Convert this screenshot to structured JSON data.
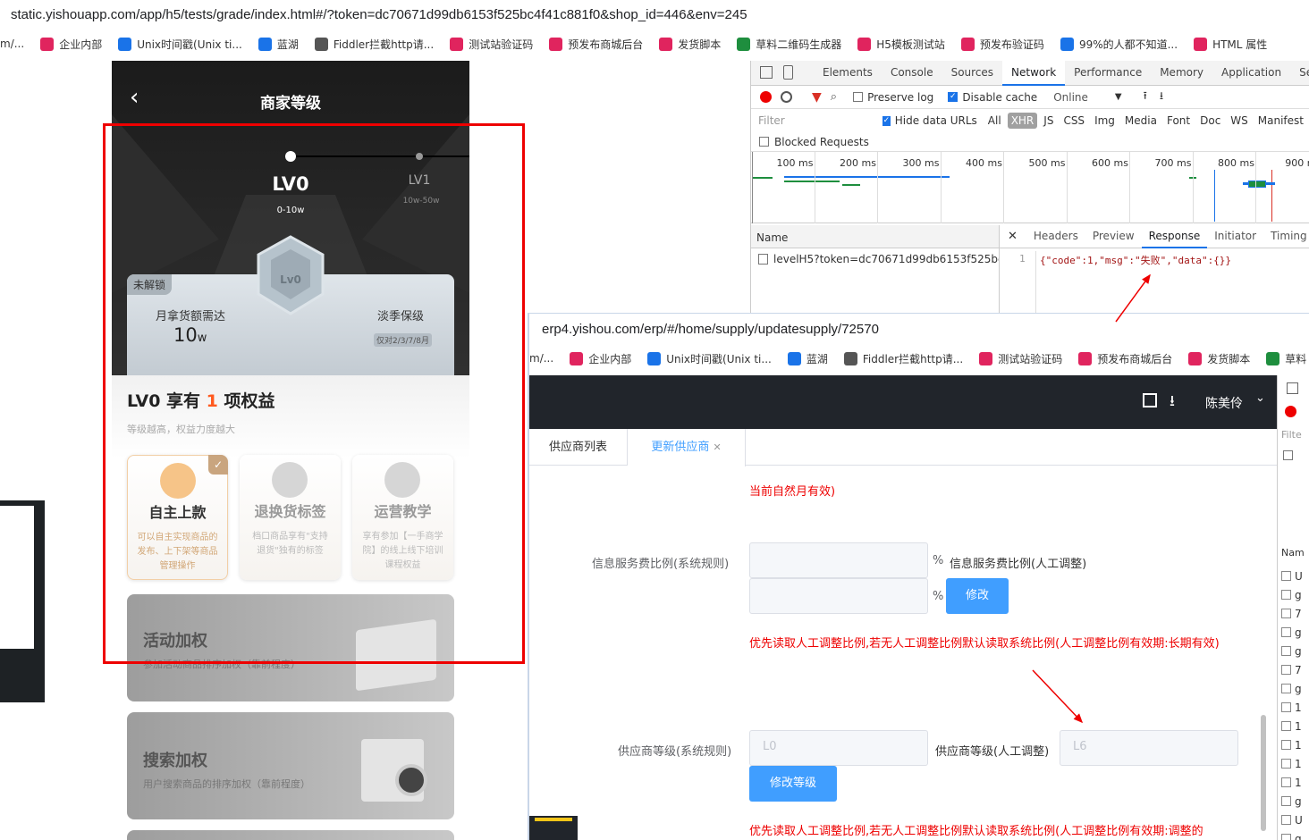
{
  "browser_top": {
    "url": "static.yishouapp.com/app/h5/tests/grade/index.html#/?token=dc70671d99db6153f525bc4f41c881f0&shop_id=446&env=245",
    "bookmarks": [
      "m/...",
      "企业内部",
      "Unix时间戳(Unix ti...",
      "蓝湖",
      "Fiddler拦截http请...",
      "测试站验证码",
      "预发布商城后台",
      "发货脚本",
      "草料二维码生成器",
      "H5模板测试站",
      "预发布验证码",
      "99%的人都不知道...",
      "HTML 属性"
    ]
  },
  "h5": {
    "title": "商家等级",
    "level_current": "LV0",
    "level_current_range": "0-10w",
    "level_next": "LV1",
    "level_next_range": "10w-50w",
    "badge_text": "Lv0",
    "locked_tag": "未解锁",
    "monthly_label": "月拿货额需达",
    "monthly_value": "10",
    "monthly_unit": "w",
    "offseason_label": "淡季保级",
    "offseason_tag": "仅对2/3/7/8月",
    "rights_prefix": "LV0 享有",
    "rights_count": "1",
    "rights_suffix": "项权益",
    "rights_sub": "等级越高，权益力度越大",
    "cards": [
      {
        "title": "自主上款",
        "desc": "可以自主实现商品的发布、上下架等商品管理操作"
      },
      {
        "title": "退换货标签",
        "desc": "档口商品享有\"支持退货\"独有的标签"
      },
      {
        "title": "运营教学",
        "desc": "享有参加【一手商学院】的线上线下培训课程权益"
      }
    ],
    "activity_title": "活动加权",
    "activity_desc": "参加活动商品排序加权（靠前程度）",
    "search_title": "搜索加权",
    "search_desc": "用户搜索商品的排序加权（靠前程度）"
  },
  "devtools": {
    "tabs": [
      "Elements",
      "Console",
      "Sources",
      "Network",
      "Performance",
      "Memory",
      "Application",
      "Secur"
    ],
    "active_tab": "Network",
    "preserve_log": "Preserve log",
    "disable_cache": "Disable cache",
    "online": "Online",
    "filter_placeholder": "Filter",
    "hide_data_urls": "Hide data URLs",
    "filter_types": [
      "All",
      "XHR",
      "JS",
      "CSS",
      "Img",
      "Media",
      "Font",
      "Doc",
      "WS",
      "Manifest"
    ],
    "blocked": "Blocked Requests",
    "timeline": [
      "100 ms",
      "200 ms",
      "300 ms",
      "400 ms",
      "500 ms",
      "600 ms",
      "700 ms",
      "800 ms",
      "900 m"
    ],
    "name_header": "Name",
    "request_name": "levelH5?token=dc70671d99db6153f525bc4f...",
    "detail_tabs": [
      "Headers",
      "Preview",
      "Response",
      "Initiator",
      "Timing"
    ],
    "active_detail": "Response",
    "line_no": "1",
    "response": "{\"code\":1,\"msg\":\"失败\",\"data\":{}}"
  },
  "erp": {
    "url": "erp4.yishou.com/erp/#/home/supply/updatesupply/72570",
    "bookmarks": [
      "m/...",
      "企业内部",
      "Unix时间戳(Unix ti...",
      "蓝湖",
      "Fiddler拦截http请...",
      "测试站验证码",
      "预发布商城后台",
      "发货脚本",
      "草料"
    ],
    "user": "陈美伶",
    "tab_list": "供应商列表",
    "tab_update": "更新供应商",
    "note_month": "当前自然月有效)",
    "fee_sys_label": "信息服务费比例(系统规则)",
    "percent": "%",
    "fee_manual_label": "信息服务费比例(人工调整)",
    "modify_btn": "修改",
    "note_fee": "优先读取人工调整比例,若无人工调整比例默认读取系统比例(人工调整比例有效期:长期有效)",
    "level_sys_label": "供应商等级(系统规则)",
    "level_sys_value": "L0",
    "level_manual_label": "供应商等级(人工调整)",
    "level_manual_value": "L6",
    "modify_level_btn": "修改等级",
    "note_level": "优先读取人工调整比例,若无人工调整比例默认读取系统比例(人工调整比例有效期:调整的",
    "side_labels": [
      "Filte",
      "Nam"
    ],
    "side_chars": [
      "U",
      "g",
      "7",
      "g",
      "g",
      "7",
      "g",
      "1",
      "1",
      "1",
      "1",
      "1",
      "g",
      "U",
      "g"
    ]
  },
  "colors": {
    "accent": "#409eff",
    "red": "#e00000",
    "orange": "#ff5a1f",
    "devtools_blue": "#1a73e8"
  }
}
